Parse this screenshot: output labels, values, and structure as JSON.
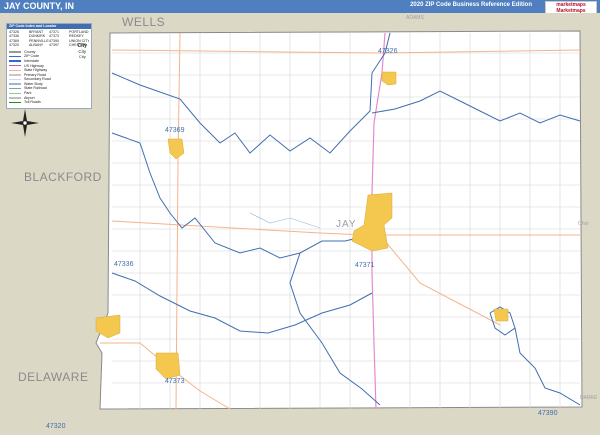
{
  "header": {
    "title": "JAY COUNTY, IN",
    "edition": "2020 ZIP Code Business Reference Edition",
    "brand_line1": "marketmaps",
    "brand_line2": "Marketmaps"
  },
  "legend": {
    "title": "ZIP Code Index and Locator",
    "zip_index": [
      "47326",
      "BRYANT",
      "47371",
      "PORTLAND",
      "47336",
      "DUNKIRK",
      "47373",
      "REDKEY",
      "47369",
      "PENNVILLE",
      "47390",
      "UNION CITY",
      "47320",
      "ALBANY",
      "47397",
      "CHESTER"
    ],
    "rows": [
      {
        "label": "County",
        "color": "#9a9a9a"
      },
      {
        "label": "ZIP Code",
        "color": "#3f6fb0"
      },
      {
        "label": "Interstate",
        "color": "#2d6bd1"
      },
      {
        "label": "US Highway",
        "color": "#c05aa0"
      },
      {
        "label": "State Highway",
        "color": "#f4b48a"
      },
      {
        "label": "Primary Road",
        "color": "#c8c8c8"
      },
      {
        "label": "Secondary Road",
        "color": "#d8d8d8"
      },
      {
        "label": "Water Body",
        "color": "#8fb7e0"
      },
      {
        "label": "State Railroad",
        "color": "#9a9a9a"
      },
      {
        "label": "Park",
        "color": "#8fcf8f"
      },
      {
        "label": "Airport",
        "color": "#bfbfbf"
      },
      {
        "label": "Toll Roads",
        "color": "#1e8f2e"
      }
    ],
    "city_sizes": [
      "City",
      "City",
      "City"
    ]
  },
  "neighbors": {
    "wells": "WELLS",
    "blackford": "BLACKFORD",
    "delaware": "DELAWARE",
    "ohio": "Ohio",
    "adams": "ADAMS",
    "darke": "DARKE"
  },
  "towns": {
    "jay": "JAY"
  },
  "zips": {
    "z47326": "47326",
    "z47369": "47369",
    "z47336": "47336",
    "z47371": "47371",
    "z47373": "47373",
    "z47390": "47390",
    "z47320": "47320"
  },
  "colors": {
    "title_bar": "#4f7fbf",
    "neighbor_land": "#dcd8c6",
    "county_land": "#ffffff",
    "zip_boundary": "#3f6fb0",
    "urban_area": "#f4c74f",
    "us_highway": "#e68ad0",
    "state_highway": "#f4b48a",
    "roads": "#d6d6d6"
  }
}
